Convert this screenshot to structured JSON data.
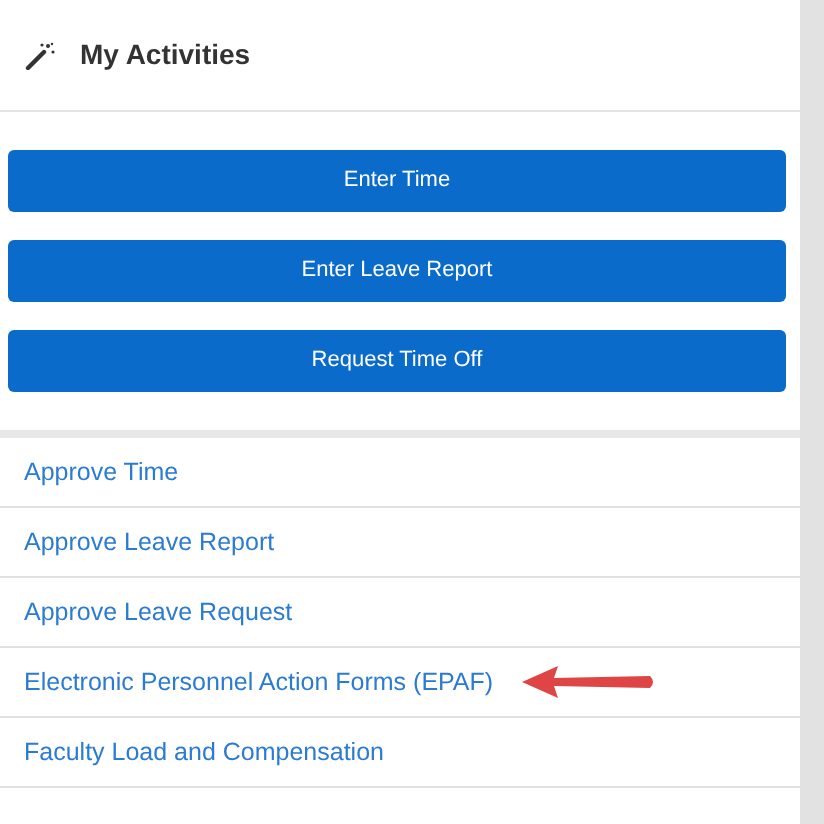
{
  "header": {
    "title": "My Activities"
  },
  "buttons": [
    "Enter Time",
    "Enter Leave Report",
    "Request Time Off"
  ],
  "links": [
    {
      "label": "Approve Time",
      "highlighted": false
    },
    {
      "label": "Approve Leave Report",
      "highlighted": false
    },
    {
      "label": "Approve Leave Request",
      "highlighted": false
    },
    {
      "label": "Electronic Personnel Action Forms (EPAF)",
      "highlighted": true
    },
    {
      "label": "Faculty Load and Compensation",
      "highlighted": false
    }
  ]
}
